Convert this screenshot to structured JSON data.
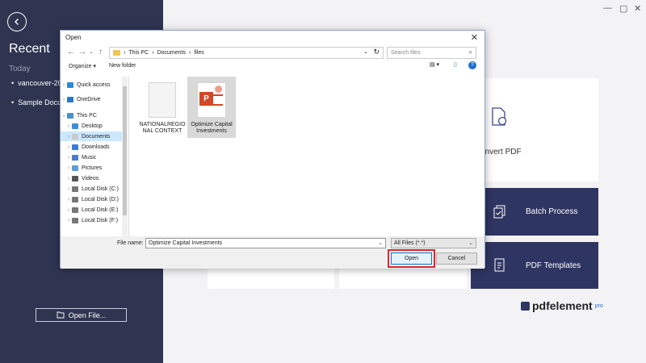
{
  "sidebar": {
    "title": "Recent",
    "section": "Today",
    "items": [
      "vancouver-20",
      "Sample Docu"
    ],
    "open_file_label": "Open File..."
  },
  "window_controls": {
    "minimize": "—",
    "restore": "▢",
    "close": "✕"
  },
  "cards": {
    "convert_label": "onvert PDF",
    "batch_label": "Batch Process",
    "templates_label": "PDF Templates"
  },
  "logo": {
    "text": "pdfelement",
    "suffix": "pro"
  },
  "dialog": {
    "title": "Open",
    "close_glyph": "✕",
    "path": [
      "This PC",
      "Documents",
      "files"
    ],
    "search_placeholder": "Search files",
    "organize_label": "Organize ▾",
    "new_folder_label": "New folder",
    "nav_items": [
      {
        "label": "Quick access",
        "expander": "›",
        "color": "#2b88d8"
      },
      {
        "label": "OneDrive",
        "expander": "›",
        "color": "#2b78c4"
      },
      {
        "label": "This PC",
        "expander": "⌄",
        "color": "#4a90c8"
      },
      {
        "label": "Desktop",
        "expander": "›",
        "color": "#3b8fdc"
      },
      {
        "label": "Documents",
        "expander": "›",
        "color": "#c9c9c9"
      },
      {
        "label": "Downloads",
        "expander": "›",
        "color": "#3a7bd5"
      },
      {
        "label": "Music",
        "expander": "›",
        "color": "#4a7bd0"
      },
      {
        "label": "Pictures",
        "expander": "›",
        "color": "#5a9fd8"
      },
      {
        "label": "Videos",
        "expander": "›",
        "color": "#555"
      },
      {
        "label": "Local Disk (C:)",
        "expander": "›",
        "color": "#777"
      },
      {
        "label": "Local Disk (D:)",
        "expander": "›",
        "color": "#777"
      },
      {
        "label": "Local Disk (E:)",
        "expander": "›",
        "color": "#777"
      },
      {
        "label": "Local Disk (F:)",
        "expander": "›",
        "color": "#777"
      }
    ],
    "files": [
      {
        "name_line1": "NATIONALREGIO",
        "name_line2": "NAL CONTEXT"
      },
      {
        "name_line1": "Optimize Capital",
        "name_line2": "Investments",
        "ppt_letter": "P"
      }
    ],
    "file_name_label": "File name:",
    "file_name_value": "Optimize Capital Investments",
    "filter_value": "All Files (*.*)",
    "open_button": "Open",
    "cancel_button": "Cancel"
  }
}
